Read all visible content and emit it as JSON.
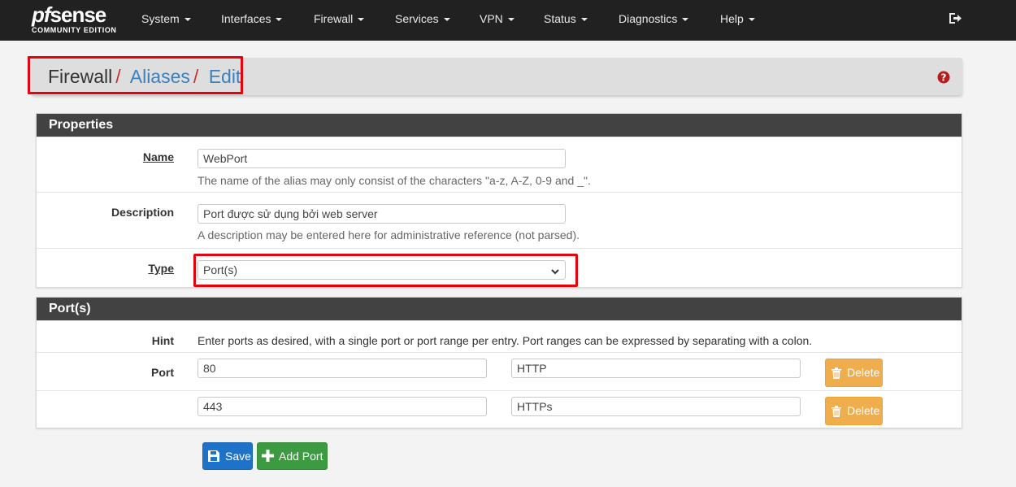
{
  "brand": {
    "logo_main_pf": "pf",
    "logo_main_sense": "sense",
    "logo_sub": "COMMUNITY EDITION"
  },
  "nav": {
    "items": [
      "System",
      "Interfaces",
      "Firewall",
      "Services",
      "VPN",
      "Status",
      "Diagnostics",
      "Help"
    ]
  },
  "breadcrumb": {
    "first": "Firewall",
    "second": "Aliases",
    "third": "Edit",
    "separator": "/"
  },
  "properties": {
    "heading": "Properties",
    "name_label": "Name",
    "name_value": "WebPort",
    "name_help": "The name of the alias may only consist of the characters \"a-z, A-Z, 0-9 and _\".",
    "description_label": "Description",
    "description_value": "Port được sử dụng bởi web server",
    "description_help": "A description may be entered here for administrative reference (not parsed).",
    "type_label": "Type",
    "type_value": "Port(s)"
  },
  "ports": {
    "heading": "Port(s)",
    "hint_label": "Hint",
    "hint_text": "Enter ports as desired, with a single port or port range per entry. Port ranges can be expressed by separating with a colon.",
    "port_label": "Port",
    "entries": [
      {
        "port": "80",
        "description": "HTTP",
        "delete_label": "Delete"
      },
      {
        "port": "443",
        "description": "HTTPs",
        "delete_label": "Delete"
      }
    ]
  },
  "actions": {
    "save_label": "Save",
    "add_port_label": "Add Port"
  },
  "colors": {
    "navbar": "#212121",
    "panel_heading": "#424242",
    "link": "#3d80c0",
    "highlight": "#e8000d",
    "save": "#1e73c8",
    "add": "#3c9a41",
    "delete": "#f0ad4e"
  }
}
